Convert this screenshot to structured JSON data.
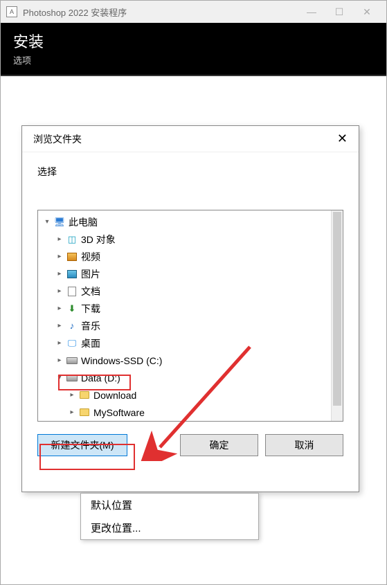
{
  "outer": {
    "title": "Photoshop 2022 安装程序",
    "header_title": "安装",
    "header_sub": "选项"
  },
  "dialog": {
    "title": "浏览文件夹",
    "select_label": "选择",
    "tree": {
      "this_pc": "此电脑",
      "threed": "3D 对象",
      "video": "视频",
      "pictures": "图片",
      "documents": "文档",
      "downloads": "下载",
      "music": "音乐",
      "desktop": "桌面",
      "c_drive": "Windows-SSD (C:)",
      "d_drive": "Data (D:)",
      "download_folder": "Download",
      "mysoftware_folder": "MySoftware"
    },
    "buttons": {
      "new_folder": "新建文件夹(M)",
      "ok": "确定",
      "cancel": "取消"
    }
  },
  "popup": {
    "default_location": "默认位置",
    "change_location": "更改位置..."
  }
}
